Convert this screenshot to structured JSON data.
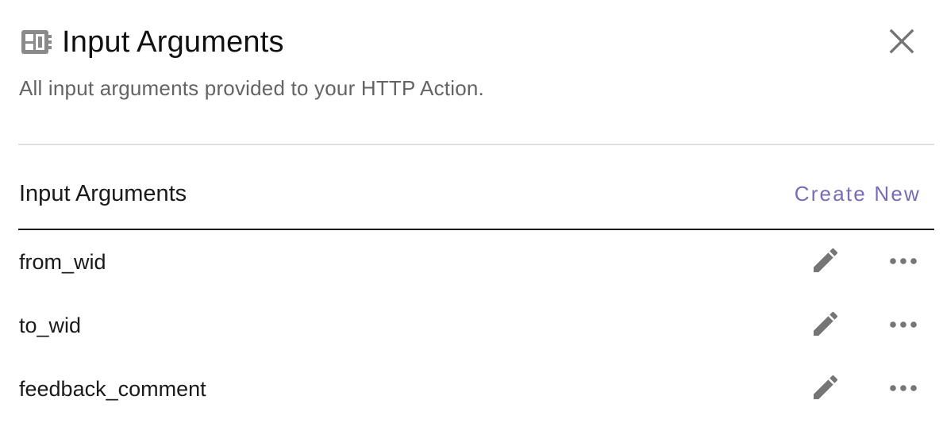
{
  "panel": {
    "title": "Input Arguments",
    "subtitle": "All input arguments provided to your HTTP Action.",
    "header_icon": "widgets-icon",
    "close_icon": "close-icon"
  },
  "section": {
    "title": "Input Arguments",
    "create_label": "Create New"
  },
  "arguments": [
    {
      "name": "from_wid"
    },
    {
      "name": "to_wid"
    },
    {
      "name": "feedback_comment"
    }
  ],
  "row_actions": {
    "edit_icon": "pencil-icon",
    "more_icon": "more-horizontal-icon"
  },
  "colors": {
    "accent": "#7a6bb8",
    "icon_gray": "#757575",
    "subtitle_gray": "#646464",
    "divider_light": "#e0e0e0",
    "divider_dark": "#1a1a1a"
  }
}
